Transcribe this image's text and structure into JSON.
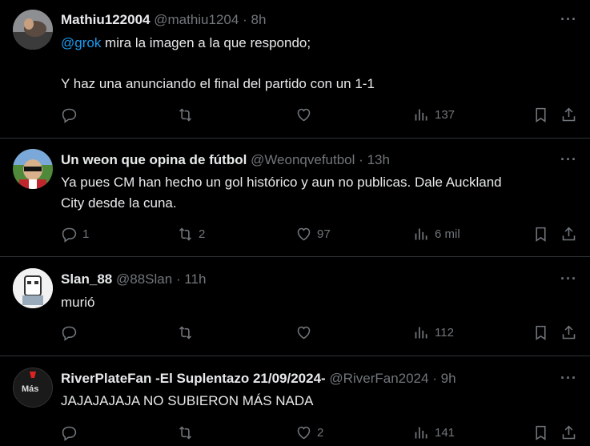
{
  "tweets": [
    {
      "name": "Mathiu122004",
      "handle": "@mathiu1204",
      "dot": "·",
      "time": "8h",
      "mention": "@grok",
      "text_line1": " mira la imagen a la que respondo;",
      "text_line2": "Y haz una anunciando el final del partido con un 1-1",
      "replies": "",
      "retweets": "",
      "likes": "",
      "views": "137"
    },
    {
      "name": "Un weon que opina de fútbol",
      "handle": "@Weonqvefutbol",
      "dot": "·",
      "time": "13h",
      "text_line1": "Ya pues CM han hecho un gol histórico y aun no publicas. Dale Auckland",
      "text_line2": "City desde la cuna.",
      "replies": "1",
      "retweets": "2",
      "likes": "97",
      "views": "6 mil"
    },
    {
      "name": "Slan_88",
      "handle": "@88Slan",
      "dot": "·",
      "time": "11h",
      "text_line1": "murió",
      "replies": "",
      "retweets": "",
      "likes": "",
      "views": "112"
    },
    {
      "name": "RiverPlateFan -El Suplentazo 21/09/2024-",
      "handle": "@RiverFan2024",
      "dot": "·",
      "time": "9h",
      "text_line1": "JAJAJAJAJA NO SUBIERON MÁS NADA",
      "avatar_text": "Más",
      "replies": "",
      "retweets": "",
      "likes": "2",
      "views": "141"
    }
  ],
  "more_label": "···",
  "colors": {
    "accent": "#1d9bf0",
    "muted": "#71767b",
    "text": "#e7e9ea",
    "border": "#2f3336"
  }
}
